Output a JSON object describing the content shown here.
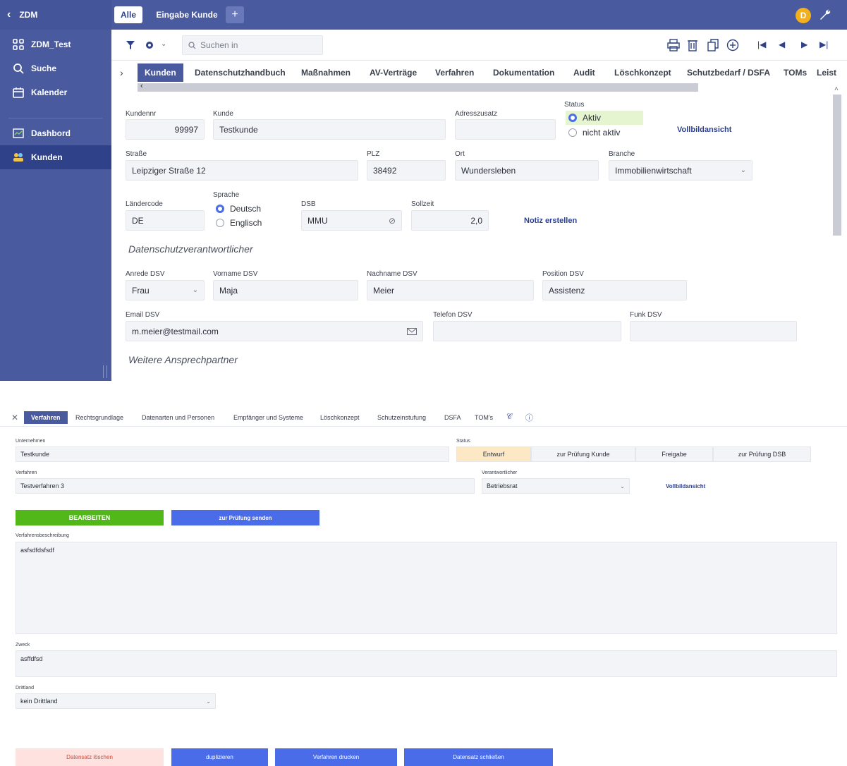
{
  "sidebar": {
    "header": "ZDM",
    "items": [
      {
        "label": "ZDM_Test",
        "icon": "grid-icon"
      },
      {
        "label": "Suche",
        "icon": "search-icon"
      },
      {
        "label": "Kalender",
        "icon": "calendar-icon"
      },
      {
        "label": "Dashbord",
        "icon": "dashboard-icon"
      },
      {
        "label": "Kunden",
        "icon": "customers-icon"
      }
    ]
  },
  "topbar": {
    "tab_all": "Alle",
    "tab_entry": "Eingabe Kunde",
    "add": "+",
    "avatar": "D"
  },
  "toolbar": {
    "search_placeholder": "Suchen in"
  },
  "tabs": [
    "Kunden",
    "Datenschutzhandbuch",
    "Maßnahmen",
    "AV-Verträge",
    "Verfahren",
    "Dokumentation",
    "Audit",
    "Löschkonzept",
    "Schutzbedarf / DSFA",
    "TOMs",
    "Leist"
  ],
  "form": {
    "kundennr_label": "Kundennr",
    "kundennr": "99997",
    "kunde_label": "Kunde",
    "kunde": "Testkunde",
    "adresszusatz_label": "Adresszusatz",
    "adresszusatz": "",
    "status_label": "Status",
    "status_active": "Aktiv",
    "status_inactive": "nicht aktiv",
    "fullscreen": "Vollbildansicht",
    "strasse_label": "Straße",
    "strasse": "Leipziger Straße 12",
    "plz_label": "PLZ",
    "plz": "38492",
    "ort_label": "Ort",
    "ort": "Wundersleben",
    "branche_label": "Branche",
    "branche": "Immobilienwirtschaft",
    "laendercode_label": "Ländercode",
    "laendercode": "DE",
    "sprache_label": "Sprache",
    "sprache_de": "Deutsch",
    "sprache_en": "Englisch",
    "dsb_label": "DSB",
    "dsb": "MMU",
    "sollzeit_label": "Sollzeit",
    "sollzeit": "2,0",
    "notiz": "Notiz erstellen",
    "dsv_heading": "Datenschutzverantwortlicher",
    "anrede_label": "Anrede DSV",
    "anrede": "Frau",
    "vorname_label": "Vorname DSV",
    "vorname": "Maja",
    "nachname_label": "Nachname DSV",
    "nachname": "Meier",
    "position_label": "Position DSV",
    "position": "Assistenz",
    "email_label": "Email DSV",
    "email": "m.meier@testmail.com",
    "telefon_label": "Telefon DSV",
    "telefon": "",
    "funk_label": "Funk DSV",
    "funk": "",
    "weitere_heading": "Weitere Ansprechpartner"
  },
  "bottom": {
    "tabs": [
      "Verfahren",
      "Rechtsgrundlage",
      "Datenarten und Personen",
      "Empfänger und Systeme",
      "Löschkonzept",
      "Schutzeinstufung",
      "DSFA",
      "TOM's"
    ],
    "unternehmen_label": "Unternehmen",
    "unternehmen": "Testkunde",
    "status_label": "Status",
    "status_steps": [
      "Entwurf",
      "zur Prüfung Kunde",
      "Freigabe",
      "zur Prüfung DSB"
    ],
    "verfahren_label": "Verfahren",
    "verfahren": "Testverfahren 3",
    "verantwortlicher_label": "Verantwortlicher",
    "verantwortlicher": "Betriebsrat",
    "fullscreen": "Vollbildansicht",
    "btn_edit": "BEARBEITEN",
    "btn_review": "zur Prüfung senden",
    "beschreibung_label": "Verfahrensbeschreibung",
    "beschreibung": "asfsdfdsfsdf",
    "zweck_label": "Zweck",
    "zweck": "asffdfsd",
    "drittland_label": "Drittland",
    "drittland": "kein Drittland",
    "btn_delete": "Datensatz löschen",
    "btn_duplicate": "duplizieren",
    "btn_print": "Verfahren drucken",
    "btn_close": "Datensatz schließen"
  },
  "colors": {
    "sidebar": "#4a5a9e",
    "selected": "#2f4289",
    "accent_blue": "#4a6ce8",
    "green": "#52b81a",
    "danger_bg": "#fde2df",
    "draft_bg": "#fde8c6",
    "active_bg": "#e4f5cf"
  }
}
